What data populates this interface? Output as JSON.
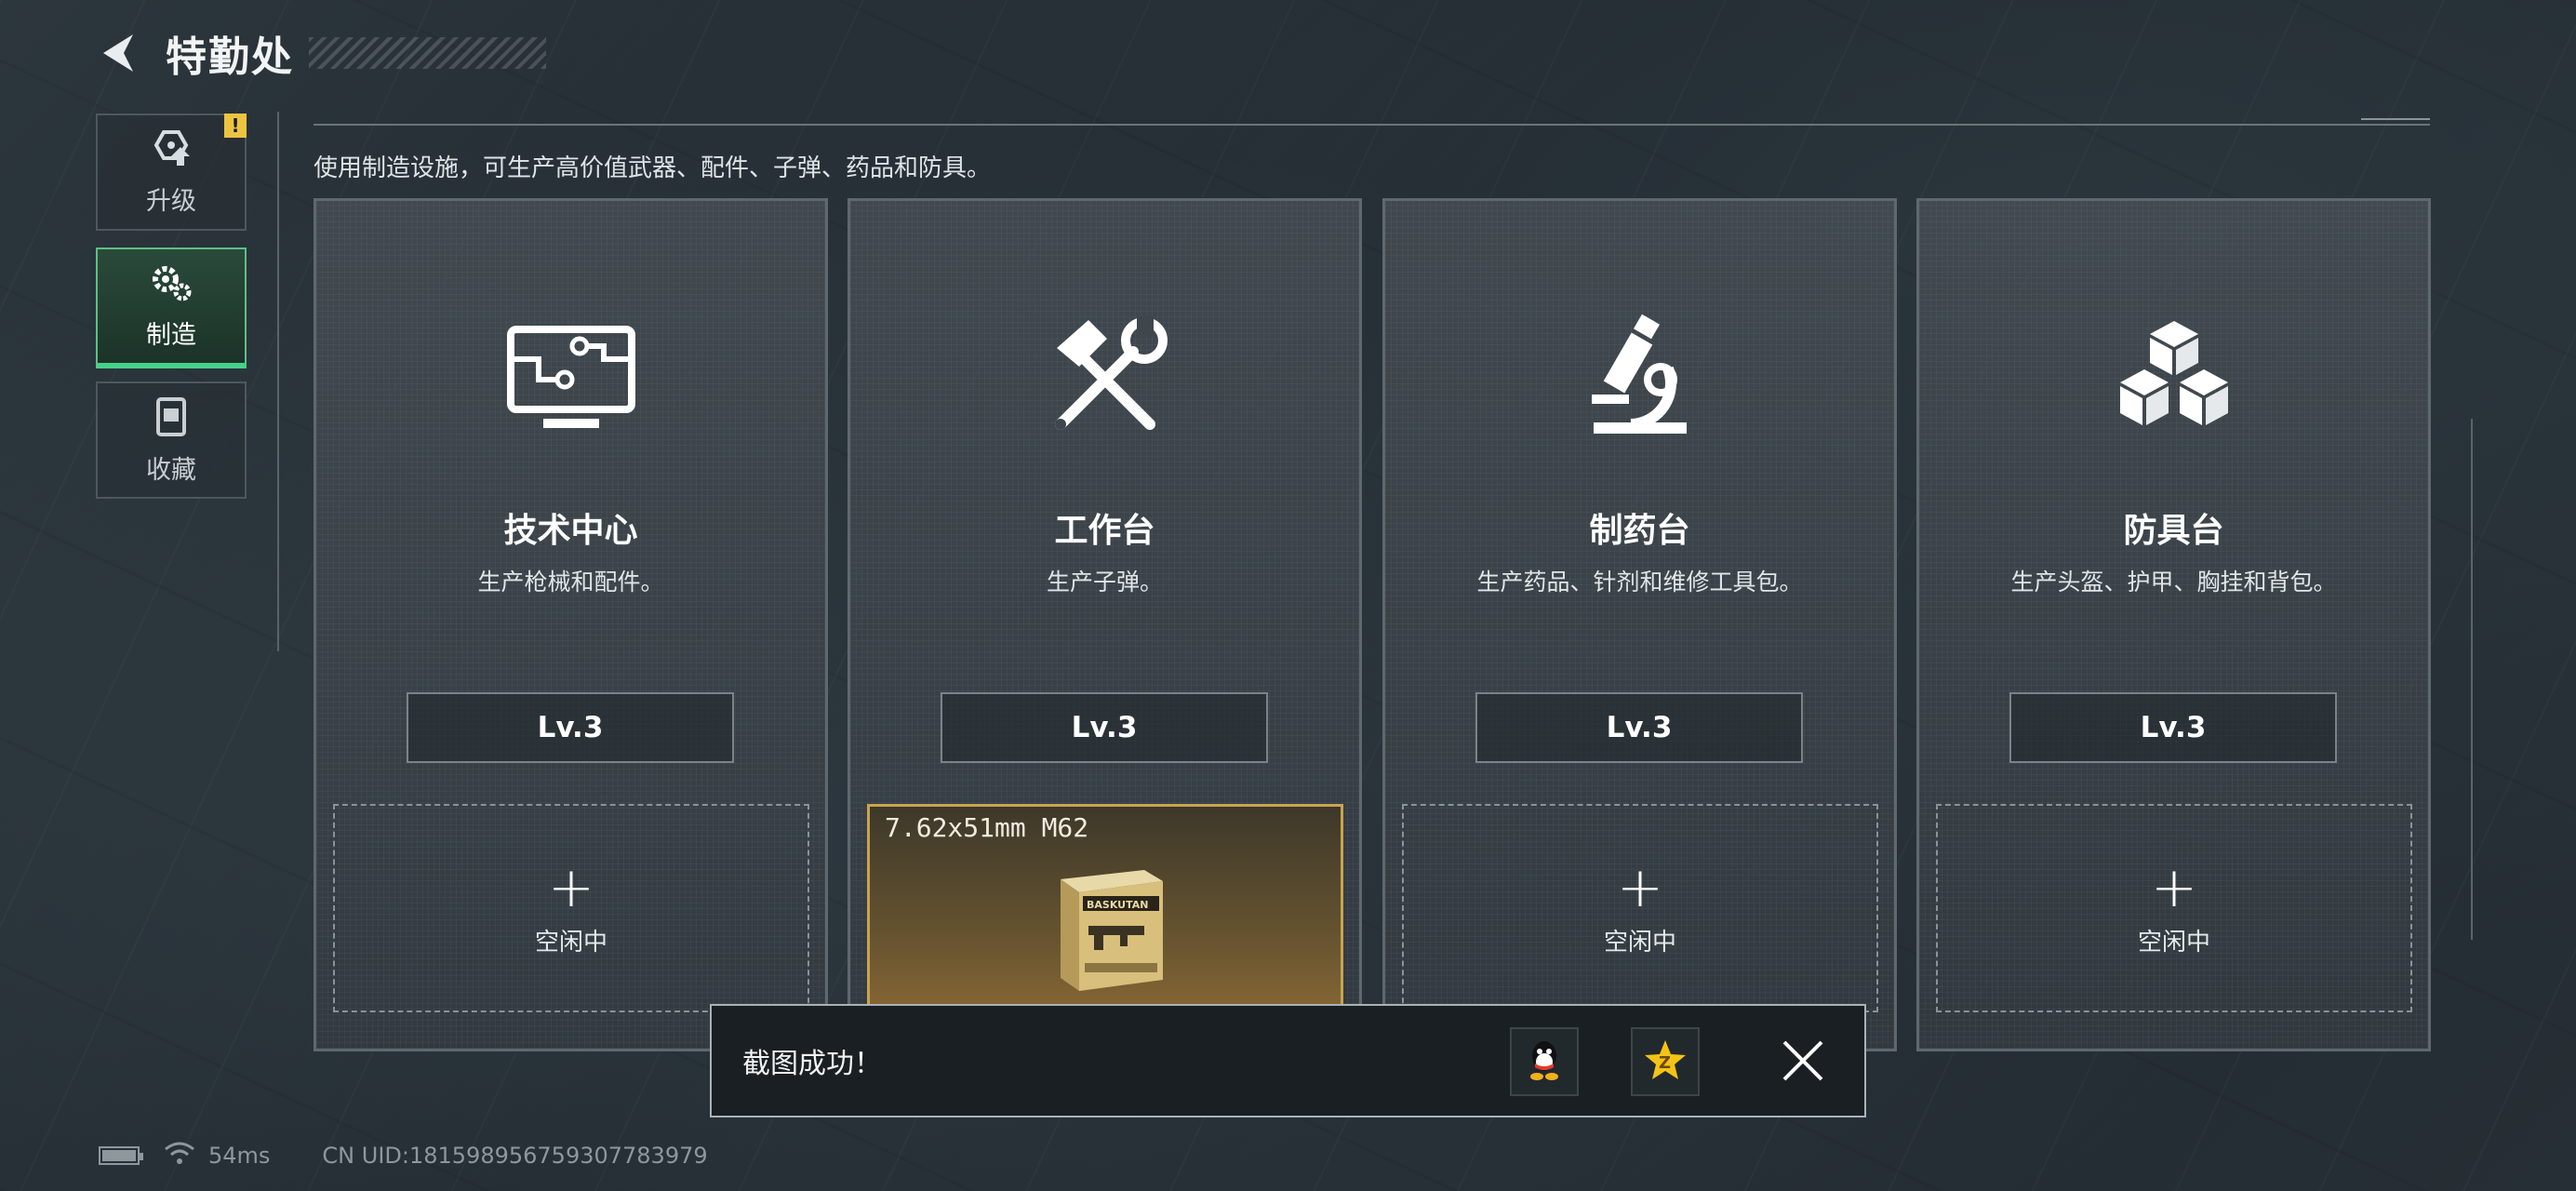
{
  "header": {
    "title": "特勤处"
  },
  "sidebar": {
    "items": [
      {
        "label": "升级",
        "icon": "upgrade-icon",
        "warning": "!"
      },
      {
        "label": "制造",
        "icon": "gears-icon",
        "active": true
      },
      {
        "label": "收藏",
        "icon": "collection-icon"
      }
    ]
  },
  "description": "使用制造设施，可生产高价值武器、配件、子弹、药品和防具。",
  "stations": [
    {
      "name": "技术中心",
      "subtitle": "生产枪械和配件。",
      "level": "Lv.3",
      "icon": "monitor-circuit-icon",
      "slot": {
        "status": "空闲中",
        "plus": "+"
      }
    },
    {
      "name": "工作台",
      "subtitle": "生产子弹。",
      "level": "Lv.3",
      "icon": "hammer-wrench-icon",
      "slot": {
        "item": "7.62x51mm M62",
        "box_brand": "BASKUTAN"
      }
    },
    {
      "name": "制药台",
      "subtitle": "生产药品、针剂和维修工具包。",
      "level": "Lv.3",
      "icon": "microscope-icon",
      "slot": {
        "status": "空闲中",
        "plus": "+"
      }
    },
    {
      "name": "防具台",
      "subtitle": "生产头盔、护甲、胸挂和背包。",
      "level": "Lv.3",
      "icon": "cubes-icon",
      "slot": {
        "status": "空闲中",
        "plus": "+"
      }
    }
  ],
  "toast": {
    "text": "截图成功！",
    "share": [
      "qq-icon",
      "qzone-icon"
    ]
  },
  "status_bar": {
    "ping": "54ms",
    "uid": "CN UID:1815989567593077839​79"
  },
  "colors": {
    "accent_green": "#46d08a",
    "warning_yellow": "#ecc440",
    "slot_gold": "#c9a44e"
  }
}
